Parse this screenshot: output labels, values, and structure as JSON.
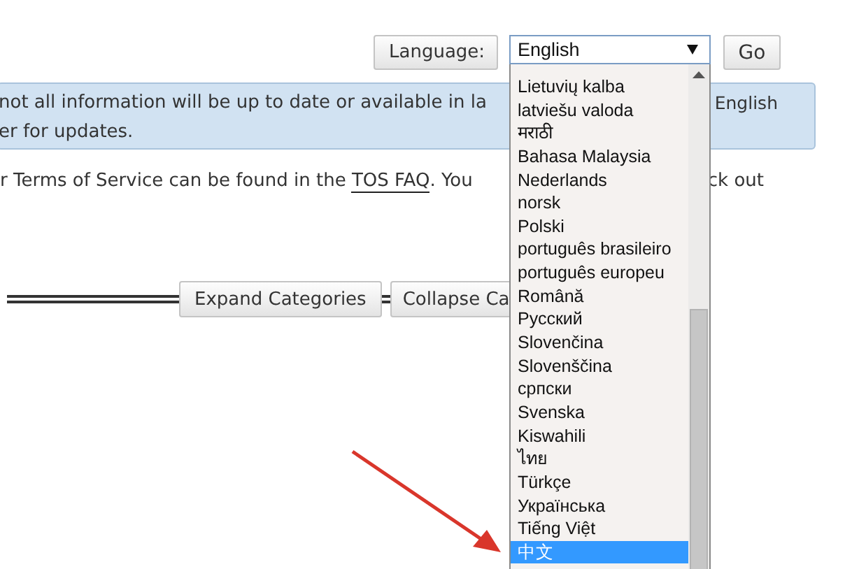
{
  "language_bar": {
    "label": "Language:",
    "select_value": "English",
    "go_button": "Go"
  },
  "language_dropdown": {
    "options": [
      {
        "label": "Lietuvių kalba",
        "selected": false
      },
      {
        "label": "latviešu valoda",
        "selected": false
      },
      {
        "label": "मराठी",
        "selected": false
      },
      {
        "label": "Bahasa Malaysia",
        "selected": false
      },
      {
        "label": "Nederlands",
        "selected": false
      },
      {
        "label": "norsk",
        "selected": false
      },
      {
        "label": "Polski",
        "selected": false
      },
      {
        "label": "português brasileiro",
        "selected": false
      },
      {
        "label": "português europeu",
        "selected": false
      },
      {
        "label": "Română",
        "selected": false
      },
      {
        "label": "Русский",
        "selected": false
      },
      {
        "label": "Slovenčina",
        "selected": false
      },
      {
        "label": "Slovenščina",
        "selected": false
      },
      {
        "label": "српски",
        "selected": false
      },
      {
        "label": "Svenska",
        "selected": false
      },
      {
        "label": "Kiswahili",
        "selected": false
      },
      {
        "label": "ไทย",
        "selected": false
      },
      {
        "label": "Türkçe",
        "selected": false
      },
      {
        "label": "Українська",
        "selected": false
      },
      {
        "label": "Tiếng Việt",
        "selected": false
      },
      {
        "label": "中文",
        "selected": true
      }
    ]
  },
  "notice": {
    "line_1_left": "not all information will be up to date or available in la",
    "line_1_right": "English",
    "line_2": "er for updates."
  },
  "tos_line": {
    "text_before": "r Terms of Service can be found in the ",
    "link": "TOS FAQ",
    "text_after": ". You",
    "text_right": "ck out"
  },
  "category_buttons": [
    "Expand Categories",
    "Collapse Ca"
  ]
}
